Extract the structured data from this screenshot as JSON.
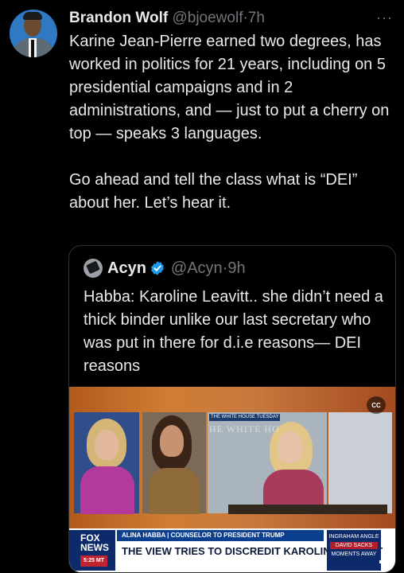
{
  "tweet": {
    "author_name": "Brandon Wolf",
    "handle": "@bjoewolf",
    "separator": "·",
    "time": "7h",
    "more_label": "···",
    "paragraphs": [
      "Karine Jean-Pierre earned two degrees, has worked in politics for 21 years, including on 5 presidential campaigns and in 2 administrations, and — just to put a cherry on top — speaks 3 languages.",
      "Go ahead and tell the class what is “DEI” about her. Let’s hear it."
    ]
  },
  "quoted_tweet": {
    "author_name": "Acyn",
    "handle": "@Acyn",
    "separator": "·",
    "time": "9h",
    "text": "Habba: Karoline Leavitt.. she didn’t need a thick binder unlike our last secretary who was put in there for d.i.e reasons— DEI reasons",
    "video": {
      "wh_label": "THE WHITE HOUSE TUESDAY",
      "wh_text": "HE WHITE HO",
      "cc_label": "CC",
      "network": "FOX NEWS",
      "clock": "5:25 MT",
      "chyron_top": "ALINA HABBA | COUNSELOR TO PRESIDENT TRUMP",
      "chyron_main": "THE VIEW TRIES TO DISCREDIT KAROLINE LEAVITT",
      "badge_show": "INGRAHAM ANGLE",
      "badge_tag": "DAVID SACKS",
      "badge_bottom": "MOMENTS AWAY"
    }
  },
  "colors": {
    "background": "#000000",
    "text": "#e7e9ea",
    "secondary": "#71767b",
    "verified": "#1d9bf0",
    "border": "#2f3336"
  }
}
